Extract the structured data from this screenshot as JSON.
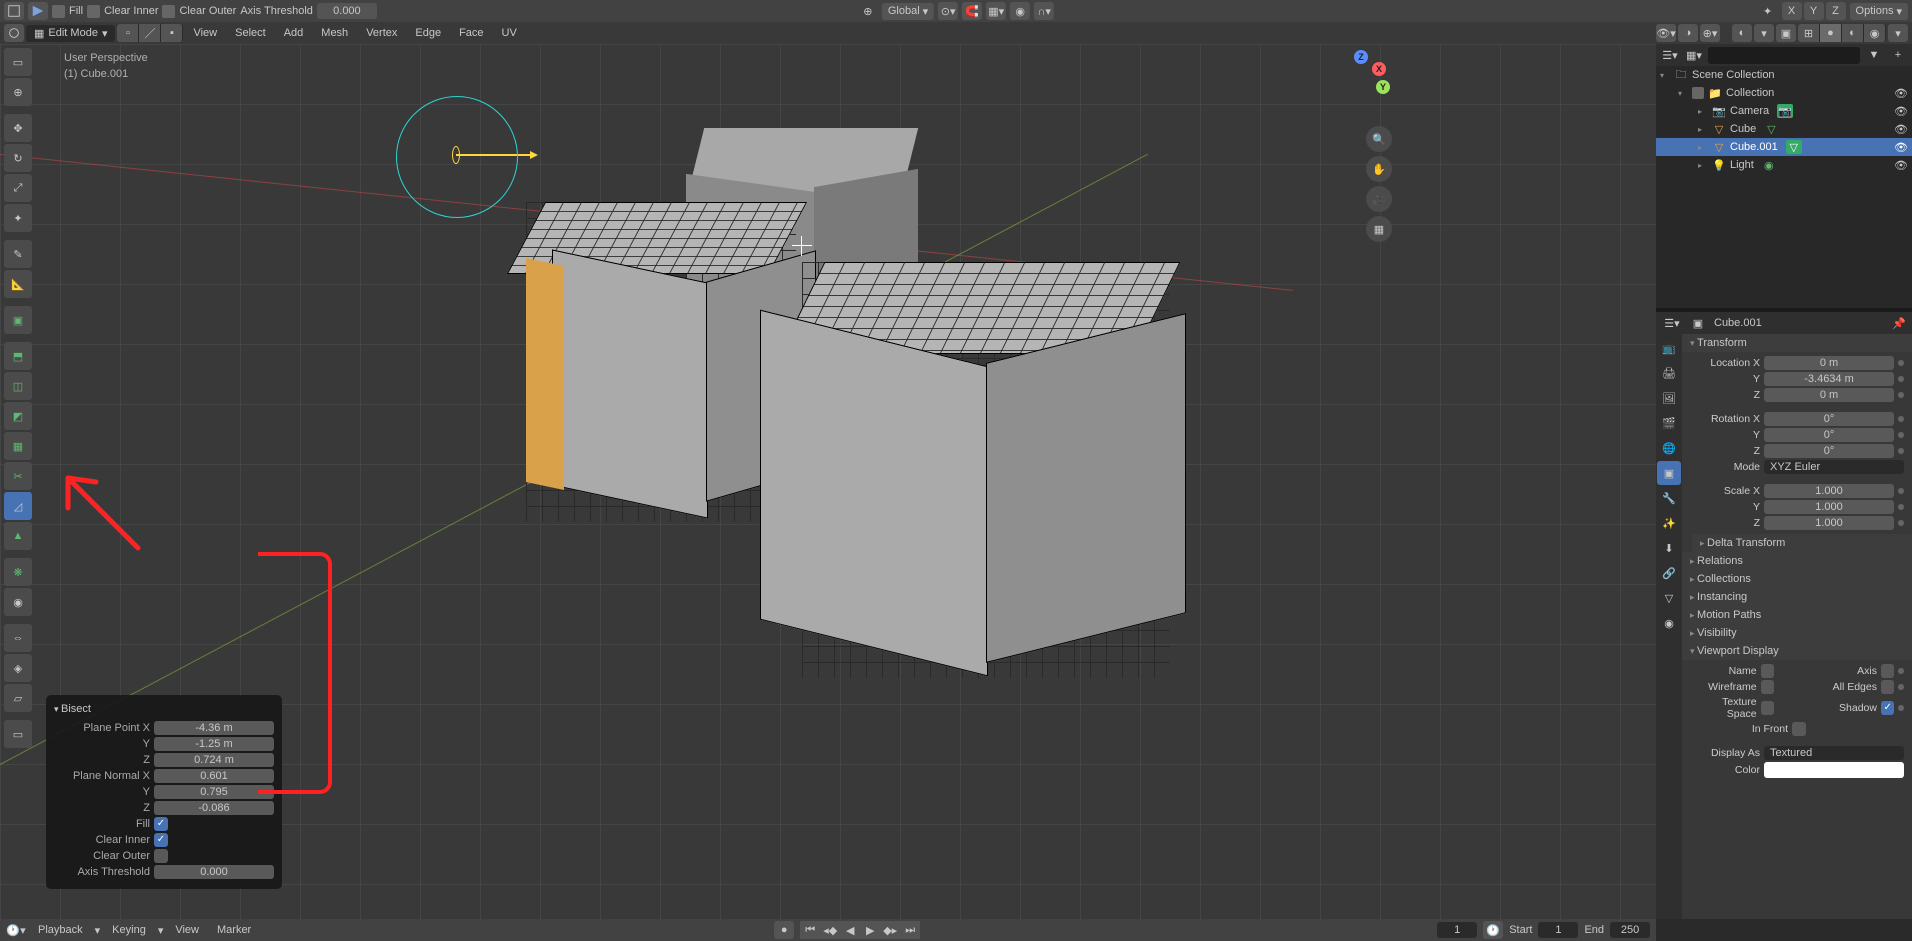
{
  "top_header": {
    "fill": "Fill",
    "clear_inner": "Clear Inner",
    "clear_outer": "Clear Outer",
    "axis_threshold_label": "Axis Threshold",
    "axis_threshold_value": "0.000",
    "orientation": "Global",
    "options": "Options",
    "axis_letters": [
      "X",
      "Y",
      "Z"
    ]
  },
  "mode_bar": {
    "mode": "Edit Mode",
    "menus": [
      "View",
      "Select",
      "Add",
      "Mesh",
      "Vertex",
      "Edge",
      "Face",
      "UV"
    ]
  },
  "viewport_label": {
    "line1": "User Perspective",
    "line2": "(1) Cube.001"
  },
  "nav_gizmo": {
    "z": "Z",
    "y": "Y",
    "x": "X"
  },
  "operator": {
    "title": "Bisect",
    "plane_point_label": "Plane Point X",
    "plane_point": {
      "x": "-4.36 m",
      "y": "-1.25 m",
      "z": "0.724 m"
    },
    "plane_normal_label": "Plane Normal X",
    "plane_normal": {
      "x": "0.601",
      "y": "0.795",
      "z": "-0.086"
    },
    "y_label": "Y",
    "z_label": "Z",
    "fill_label": "Fill",
    "clear_inner_label": "Clear Inner",
    "clear_outer_label": "Clear Outer",
    "axis_threshold_label": "Axis Threshold",
    "axis_threshold_value": "0.000",
    "fill_checked": true,
    "clear_inner_checked": true,
    "clear_outer_checked": false
  },
  "outliner": {
    "search_placeholder": "",
    "root": "Scene Collection",
    "collection": "Collection",
    "items": [
      {
        "name": "Camera",
        "icon": "📷",
        "selected": false
      },
      {
        "name": "Cube",
        "icon": "▣",
        "selected": false
      },
      {
        "name": "Cube.001",
        "icon": "▣",
        "selected": true
      },
      {
        "name": "Light",
        "icon": "💡",
        "selected": false
      }
    ]
  },
  "props": {
    "object_name": "Cube.001",
    "transform_title": "Transform",
    "location_label": "Location X",
    "location": {
      "x": "0 m",
      "y": "-3.4634 m",
      "z": "0 m"
    },
    "rotation_label": "Rotation X",
    "rotation": {
      "x": "0°",
      "y": "0°",
      "z": "0°"
    },
    "mode_label": "Mode",
    "mode_value": "XYZ Euler",
    "scale_label": "Scale X",
    "scale": {
      "x": "1.000",
      "y": "1.000",
      "z": "1.000"
    },
    "y_label": "Y",
    "z_label": "Z",
    "sections": [
      "Delta Transform",
      "Relations",
      "Collections",
      "Instancing",
      "Motion Paths",
      "Visibility"
    ],
    "viewport_display_title": "Viewport Display",
    "vd": {
      "name_label": "Name",
      "axis_label": "Axis",
      "wireframe_label": "Wireframe",
      "all_edges_label": "All Edges",
      "texture_space_label": "Texture Space",
      "shadow_label": "Shadow",
      "in_front_label": "In Front",
      "display_as_label": "Display As",
      "display_as_value": "Textured",
      "color_label": "Color"
    }
  },
  "timeline": {
    "menus": [
      "Playback",
      "Keying",
      "View",
      "Marker"
    ],
    "current_frame": "1",
    "start_label": "Start",
    "start_value": "1",
    "end_label": "End",
    "end_value": "250"
  },
  "tool_names": [
    "select-box",
    "cursor",
    "move",
    "rotate",
    "scale",
    "transform",
    "annotate",
    "measure",
    "add-cube",
    "extrude-region",
    "inset-faces",
    "bevel",
    "loop-cut",
    "knife",
    "bisect",
    "poly-build",
    "spin",
    "smooth",
    "edge-slide",
    "shrink-fatten",
    "shear",
    "rip-region"
  ]
}
